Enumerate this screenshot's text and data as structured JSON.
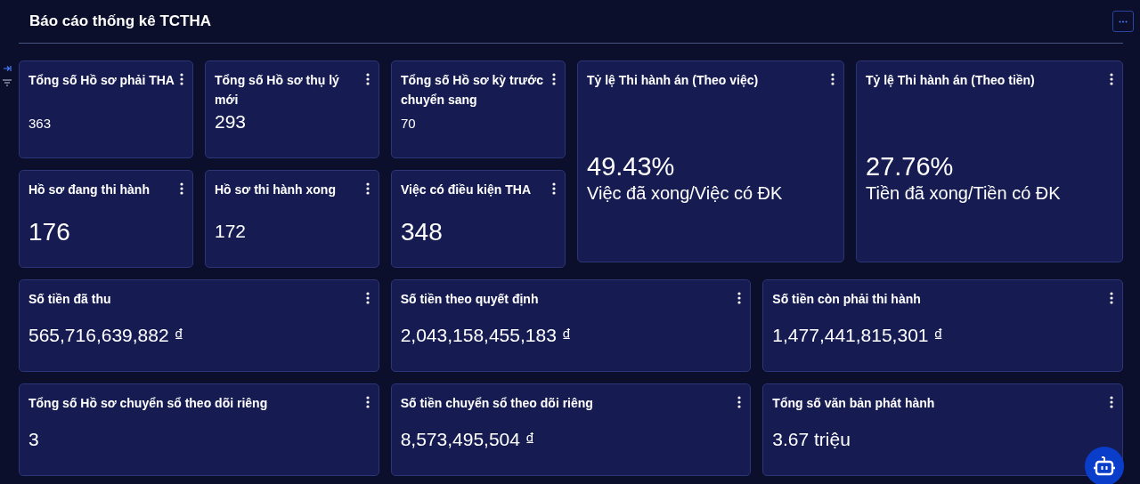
{
  "header": {
    "title": "Báo cáo thống kê TCTHA"
  },
  "small_cards": [
    {
      "title": "Tổng số Hồ sơ phải THA",
      "value": "363",
      "kind": "small"
    },
    {
      "title": "Tổng số Hồ sơ thụ lý mới",
      "value": "293",
      "kind": "medium"
    },
    {
      "title": "Tổng số Hồ sơ kỳ trước chuyển sang",
      "value": "70",
      "kind": "small"
    },
    {
      "title": "Hồ sơ đang thi hành",
      "value": "176",
      "kind": "large"
    },
    {
      "title": "Hồ sơ thi hành xong",
      "value": "172",
      "kind": "medium"
    },
    {
      "title": "Việc có điều kiện THA",
      "value": "348",
      "kind": "large"
    }
  ],
  "ratio_cards": [
    {
      "title": "Tỷ lệ Thi hành án (Theo việc)",
      "value": "49.43%",
      "caption": "Việc đã xong/Việc có ĐK"
    },
    {
      "title": "Tỷ lệ Thi hành án (Theo tiền)",
      "value": "27.76%",
      "caption": "Tiền đã xong/Tiền có ĐK"
    }
  ],
  "wide_cards": [
    {
      "title": "Số tiền đã thu",
      "value": "565,716,639,882 ₫"
    },
    {
      "title": "Số tiền theo quyết định",
      "value": "2,043,158,455,183 ₫"
    },
    {
      "title": "Số tiền còn phải thi hành",
      "value": "1,477,441,815,301 ₫"
    },
    {
      "title": "Tổng số Hồ sơ chuyển sổ theo dõi riêng",
      "value": "3"
    },
    {
      "title": "Số tiền chuyển sổ theo dõi riêng",
      "value": "8,573,495,504 ₫"
    },
    {
      "title": "Tổng số văn bản phát hành",
      "value": "3.67 triệu"
    }
  ]
}
